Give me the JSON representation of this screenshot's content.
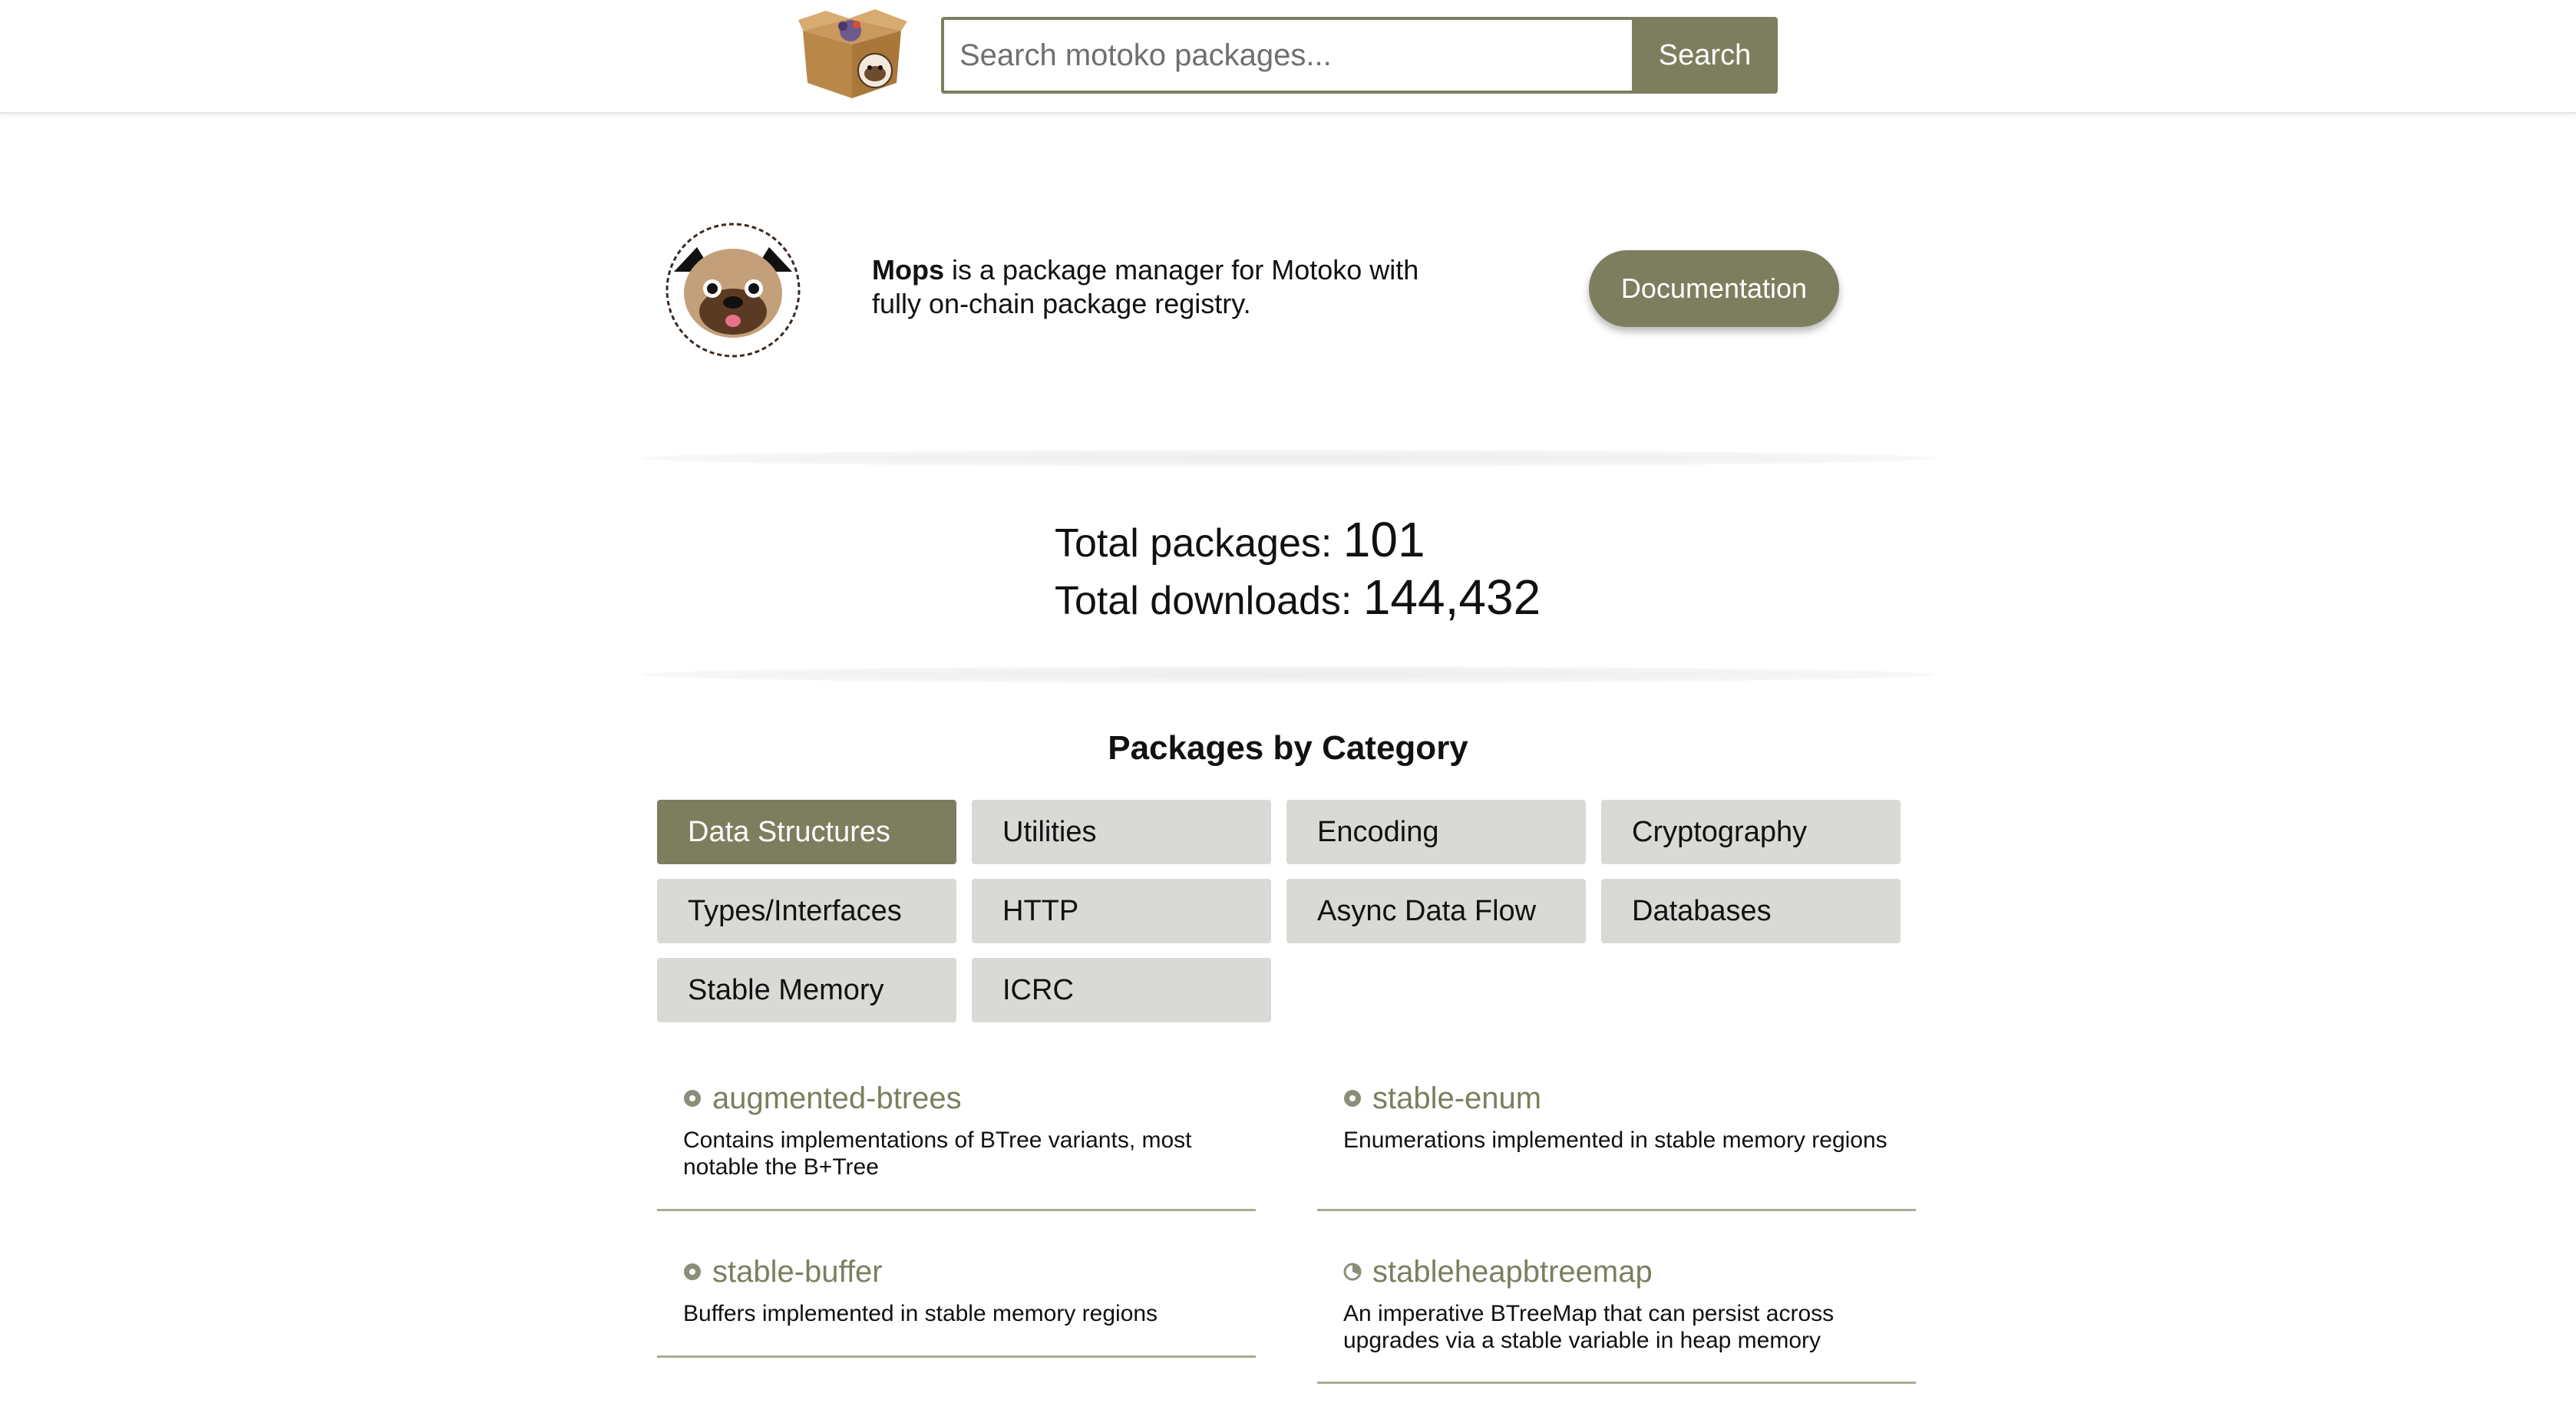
{
  "header": {
    "search": {
      "placeholder": "Search motoko packages...",
      "value": ""
    },
    "search_button": "Search"
  },
  "hero": {
    "brand": "Mops",
    "description": " is a package manager for Motoko with fully on-chain package registry.",
    "doc_button": "Documentation"
  },
  "stats": {
    "packages_label": "Total packages: ",
    "packages_value": "101",
    "downloads_label": "Total downloads: ",
    "downloads_value": "144,432"
  },
  "categories": {
    "title": "Packages by Category",
    "items": [
      {
        "label": "Data Structures",
        "active": true
      },
      {
        "label": "Utilities",
        "active": false
      },
      {
        "label": "Encoding",
        "active": false
      },
      {
        "label": "Cryptography",
        "active": false
      },
      {
        "label": "Types/Interfaces",
        "active": false
      },
      {
        "label": "HTTP",
        "active": false
      },
      {
        "label": "Async Data Flow",
        "active": false
      },
      {
        "label": "Databases",
        "active": false
      },
      {
        "label": "Stable Memory",
        "active": false
      },
      {
        "label": "ICRC",
        "active": false
      }
    ]
  },
  "packages": [
    {
      "name": "augmented-btrees",
      "description": "Contains implementations of BTree variants, most notable the B+Tree",
      "icon": "package-status-icon"
    },
    {
      "name": "stable-enum",
      "description": "Enumerations implemented in stable memory regions",
      "icon": "package-status-icon"
    },
    {
      "name": "stable-buffer",
      "description": "Buffers implemented in stable memory regions",
      "icon": "package-status-icon"
    },
    {
      "name": "stableheapbtreemap",
      "description": "An imperative BTreeMap that can persist across upgrades via a stable variable in heap memory",
      "icon": "package-status-partial-icon"
    }
  ],
  "colors": {
    "accent": "#7d7e5e",
    "category_bg": "#d9dad6"
  }
}
